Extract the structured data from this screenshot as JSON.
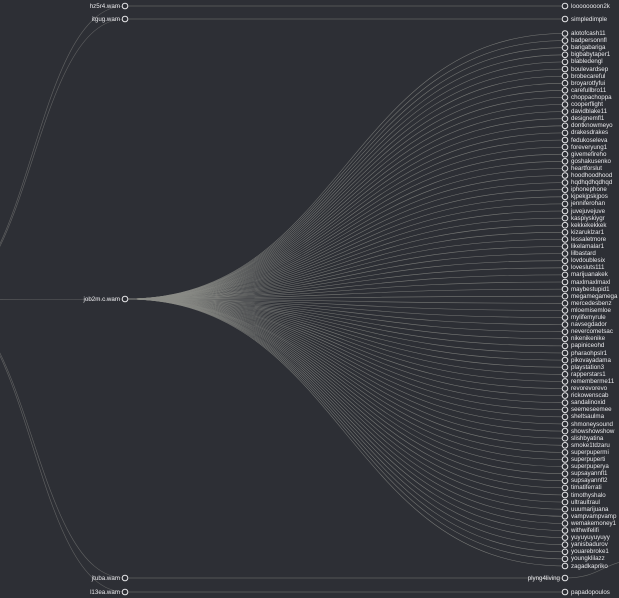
{
  "colors": {
    "background": "#2d2f35",
    "link": "#8c8d88",
    "node_stroke": "#e6e6e8",
    "node_fill": "#2d2f35",
    "label": "#e9e9ec"
  },
  "tree": {
    "left_nodes": [
      "hz5r4.wam",
      "itgug.wam",
      "job2m.c.wam",
      "jtuba.wam",
      "l13ea.wam"
    ],
    "hub": "job2m.c.wam",
    "top_right": [
      "loooooooon2k",
      "simpledimple"
    ],
    "fan_leaves": [
      "alotofcash11",
      "badpersonnfl",
      "barigabariga",
      "bigbabytaper1",
      "blabledengl",
      "boulevardsep",
      "brobecareful",
      "broyarotfyfui",
      "carefullbro11",
      "choppachoppa",
      "cooperflight",
      "davidblake11",
      "designemfl1",
      "dontknowmeyo",
      "drakesdrakes",
      "fedukoseleva",
      "foreveryung1",
      "givemefireho",
      "goshakusenko",
      "heartforslut",
      "hoodhoodhood",
      "hqdhqdhqdhqd",
      "iphonephone",
      "kjpekjpskjpos",
      "jenniferohan",
      "juvejuvejuve",
      "kaspiyskiygr",
      "kekkekekkek",
      "kizaruklzar1",
      "lessaletmore",
      "likelamalar1",
      "lilbastard",
      "lovdoublesix",
      "lovesluts111",
      "marijuanakek",
      "maxlmaxlmaxl",
      "maybestupid1",
      "megamegamega",
      "mercedesbenz",
      "mloemisemloe",
      "mylifemyrule",
      "navsegdador",
      "nevercometsac",
      "nikenikenike",
      "papiniceohd",
      "pharaohpslr1",
      "pikovayadama",
      "playstation3",
      "rapperstars1",
      "rememberme11",
      "revorevorevo",
      "rickowenscab",
      "sandalinoxid",
      "seemeseemee",
      "sheltsaulma",
      "shmoneysound",
      "showshowshow",
      "slishbyatina",
      "smoke1tdzaru",
      "superpupermi",
      "superpuperti",
      "superpuperya",
      "supsayannfl1",
      "supsayannfl2",
      "timatiferrati",
      "timothyshalo",
      "ultraultraul",
      "uuumarijuana",
      "vampvampvamp",
      "wemakemoney1",
      "withwifelifi",
      "yuyuyuyuyuyy",
      "yanisbadurov",
      "youarebroke1",
      "youngklilazz",
      "zagadkapriko"
    ],
    "bottom_right": [
      "plyng4living",
      "papadopoulos"
    ]
  }
}
